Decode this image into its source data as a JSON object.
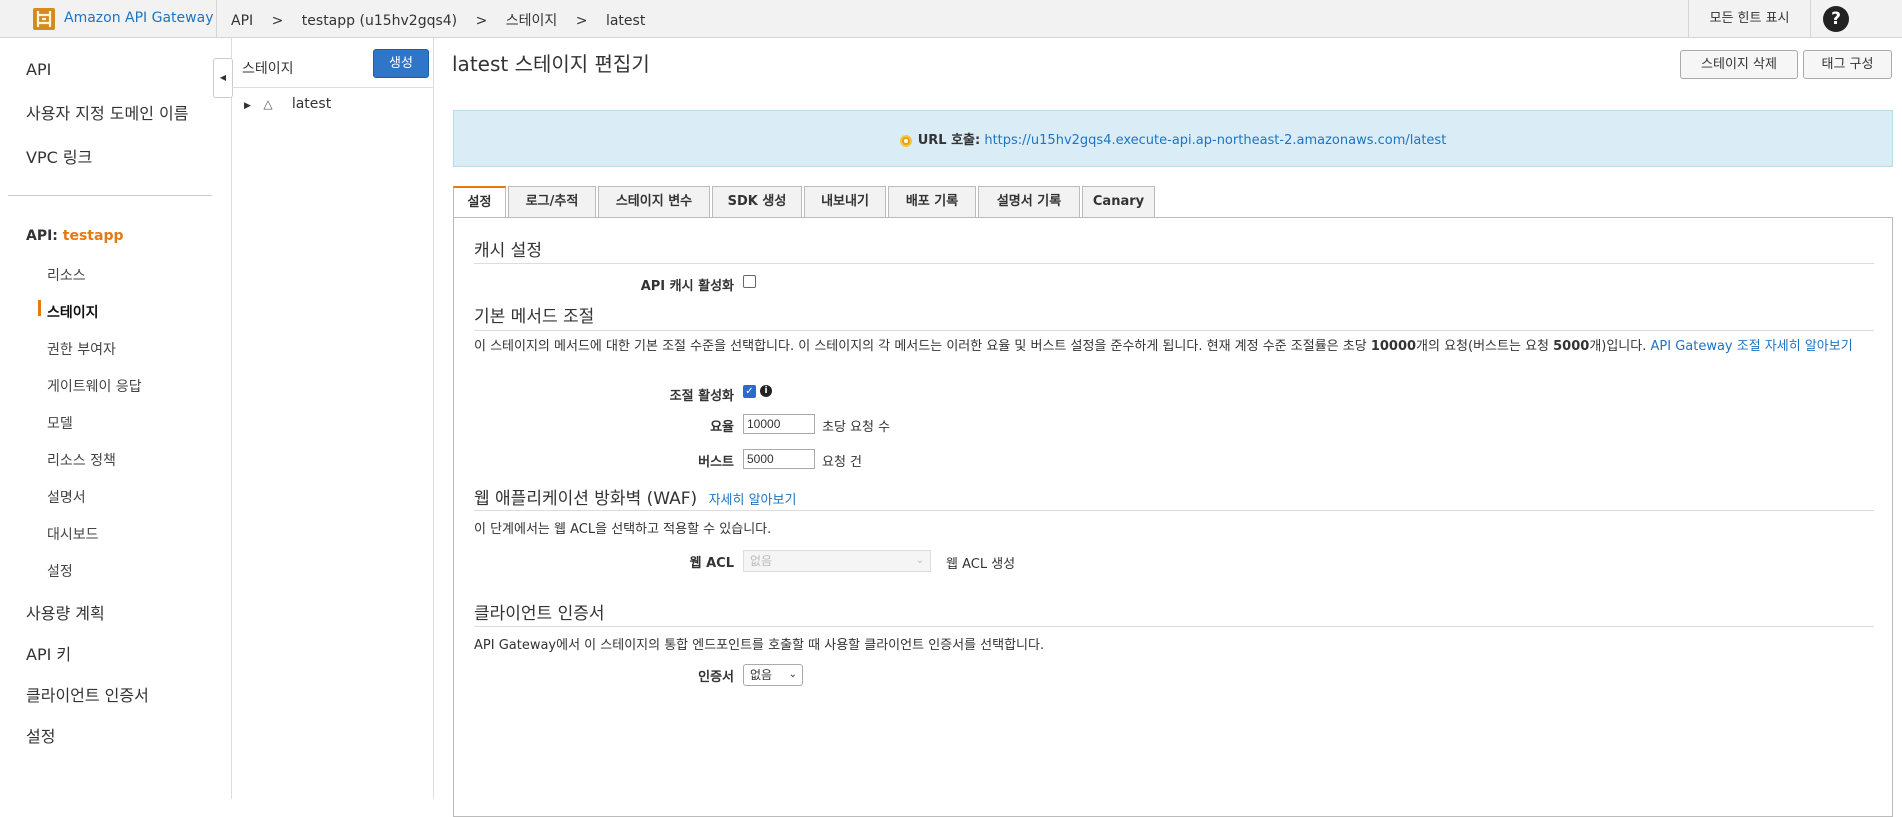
{
  "topbar": {
    "brand": "Amazon API Gateway",
    "breadcrumbs": [
      "API",
      ">",
      "testapp (u15hv2gqs4)",
      ">",
      "스테이지",
      ">",
      "latest"
    ],
    "hints_label": "모든 힌트 표시",
    "help": "?"
  },
  "nav": {
    "top_items": [
      "API",
      "사용자 지정 도메인 이름",
      "VPC 링크"
    ],
    "api_prefix": "API:",
    "api_name": "testapp",
    "sub_items": [
      "리소스",
      "스테이지",
      "권한 부여자",
      "게이트웨이 응답",
      "모델",
      "리소스 정책",
      "설명서",
      "대시보드",
      "설정"
    ],
    "bottom_items": [
      "사용량 계획",
      "API 키",
      "클라이언트 인증서",
      "설정"
    ]
  },
  "tree": {
    "header": "스테이지",
    "create_label": "생성",
    "node_label": "latest"
  },
  "main": {
    "title": "latest 스테이지 편집기",
    "delete_label": "스테이지 삭제",
    "tags_label": "태그 구성",
    "invoke_label": "URL 호출:",
    "invoke_url": "https://u15hv2gqs4.execute-api.ap-northeast-2.amazonaws.com/latest",
    "tabs": [
      "설정",
      "로그/추적",
      "스테이지 변수",
      "SDK 생성",
      "내보내기",
      "배포 기록",
      "설명서 기록",
      "Canary"
    ]
  },
  "settings": {
    "cache_heading": "캐시 설정",
    "cache_label": "API 캐시 활성화",
    "throttle_heading": "기본 메서드 조절",
    "throttle_desc_1": "이 스테이지의 메서드에 대한 기본 조절 수준을 선택합니다. 이 스테이지의 각 메서드는 이러한 요율 및 버스트 설정을 준수하게 됩니다. 현재 계정 수준 조절률은 초당 ",
    "throttle_desc_rate": "10000",
    "throttle_desc_2": "개의 요청(버스트는 요청 ",
    "throttle_desc_burst": "5000",
    "throttle_desc_3": "개)입니다. ",
    "throttle_link": "API Gateway 조절 자세히 알아보기",
    "throttle_enable_label": "조절 활성화",
    "rate_label": "요율",
    "rate_value": "10000",
    "rate_unit": "초당 요청 수",
    "burst_label": "버스트",
    "burst_value": "5000",
    "burst_unit": "요청 건",
    "waf_heading": "웹 애플리케이션 방화벽 (WAF)",
    "waf_link": "자세히 알아보기",
    "waf_desc": "이 단계에서는 웹 ACL을 선택하고 적용할 수 있습니다.",
    "webacl_label": "웹 ACL",
    "webacl_value": "없음",
    "webacl_create": "웹 ACL 생성",
    "cert_heading": "클라이언트 인증서",
    "cert_desc": "API Gateway에서 이 스테이지의 통합 엔드포인트를 호출할 때 사용할 클라이언트 인증서를 선택합니다.",
    "cert_label": "인증서",
    "cert_value": "없음"
  },
  "colors": {
    "accent": "#e47911",
    "link": "#2074c2",
    "primary": "#2f76c9"
  }
}
